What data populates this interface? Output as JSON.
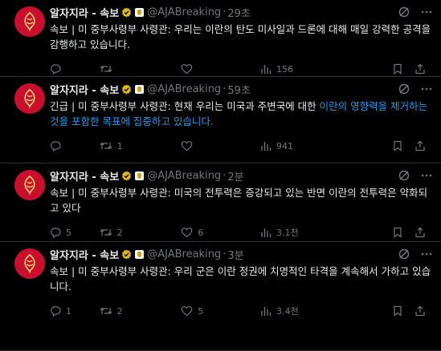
{
  "account": {
    "name": "알자지라 - 속보",
    "handle": "@AJABreaking",
    "dot": "·"
  },
  "colors": {
    "accent": "#1d9bf0",
    "avatar_bg": "#c8102e",
    "muted": "#71767b"
  },
  "icons": [
    "grok-icon",
    "more-icon",
    "reply-icon",
    "retweet-icon",
    "like-icon",
    "views-icon",
    "bookmark-icon",
    "share-icon",
    "verified-icon",
    "affiliate-badge-icon"
  ],
  "tweets": [
    {
      "time": "29초",
      "text": "속보 | 미 중부사령부 사령관: 우리는 이란의 탄도 미사일과 드론에 대해 매일 강력한 공격을 감행하고 있습니다.",
      "link_text": "",
      "replies": "",
      "retweets": "",
      "likes": "",
      "views": "156"
    },
    {
      "time": "59초",
      "text": "긴급 | 미 중부사령부 사령관: 현재 우리는 미국과 주변국에 대한 ",
      "link_text": "이란의 영향력을 제거하는 것을 포함한 목표에 집중하고 있습니다.",
      "replies": "",
      "retweets": "1",
      "likes": "",
      "views": "941"
    },
    {
      "time": "2분",
      "text": "속보 | 미 중부사령부 사령관: 미국의 전투력은 증강되고 있는 반면 이란의 전투력은 약화되고 있다",
      "link_text": "",
      "replies": "5",
      "retweets": "2",
      "likes": "6",
      "views": "3.1천"
    },
    {
      "time": "3분",
      "text": "속보 | 미 중부사령부 사령관: 우리 군은 이란 정권에 치명적인 타격을 계속해서 가하고 있습니다.",
      "link_text": "",
      "replies": "1",
      "retweets": "2",
      "likes": "5",
      "views": "3.4천"
    }
  ]
}
